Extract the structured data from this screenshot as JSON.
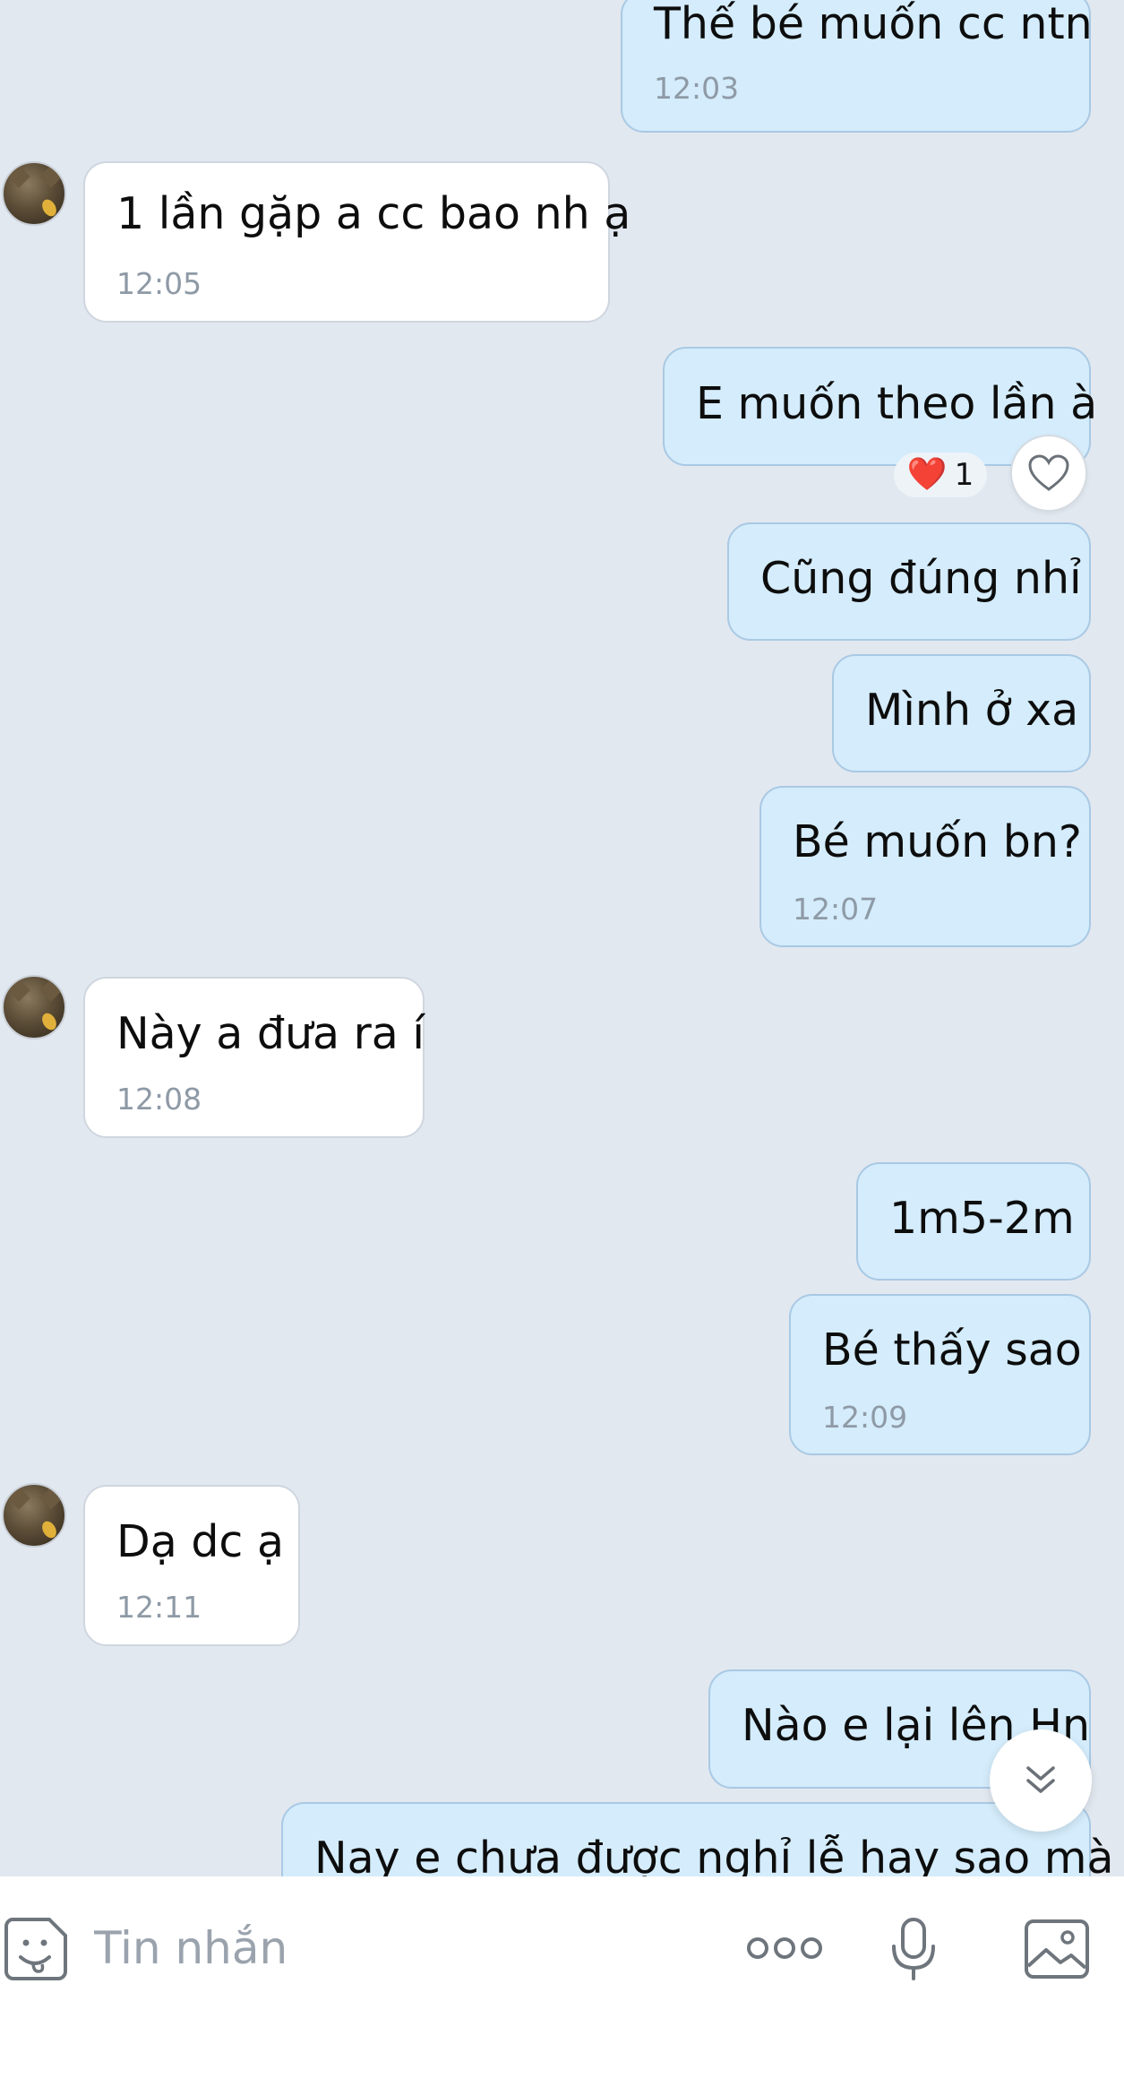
{
  "messages": [
    {
      "direction": "out",
      "text": "Thế bé muốn cc ntn",
      "time": "12:03"
    },
    {
      "direction": "in",
      "text": "1 lần gặp a cc bao nh ạ",
      "time": "12:05"
    },
    {
      "direction": "out",
      "text": "E muốn theo lần à",
      "time": "",
      "reaction": {
        "emoji": "❤️",
        "count": "1"
      }
    },
    {
      "direction": "out",
      "text": "Cũng đúng nhỉ",
      "time": ""
    },
    {
      "direction": "out",
      "text": "Mình ở xa",
      "time": ""
    },
    {
      "direction": "out",
      "text": "Bé muốn bn?",
      "time": "12:07"
    },
    {
      "direction": "in",
      "text": "Này a đưa ra í",
      "time": "12:08"
    },
    {
      "direction": "out",
      "text": "1m5-2m",
      "time": ""
    },
    {
      "direction": "out",
      "text": "Bé thấy sao",
      "time": "12:09"
    },
    {
      "direction": "in",
      "text": "Dạ dc ạ",
      "time": "12:11"
    },
    {
      "direction": "out",
      "text": "Nào e lại lên Hn",
      "time": ""
    },
    {
      "direction": "out",
      "text": "Nay e chưa được nghỉ lễ hay sao mà",
      "time": ""
    }
  ],
  "reaction": {
    "emoji": "❤️",
    "count": "1"
  },
  "composer": {
    "placeholder": "Tin nhắn",
    "icons": [
      "sticker-icon",
      "more-icon",
      "microphone-icon",
      "image-icon"
    ]
  },
  "colors": {
    "background": "#e2e8f0",
    "outgoing_bubble": "#d4ecfb",
    "incoming_bubble": "#ffffff",
    "timestamp": "#8e9aa6"
  }
}
